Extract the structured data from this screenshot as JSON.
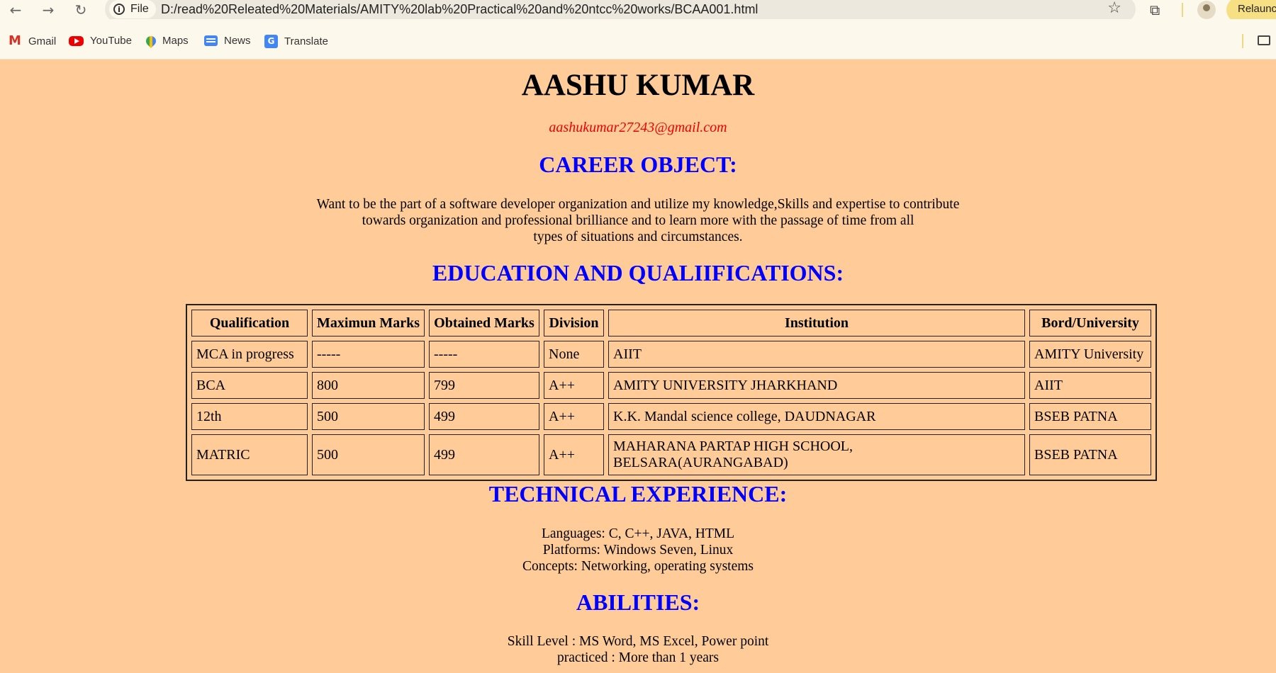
{
  "browser": {
    "chip_label": "File",
    "url": "D:/read%20Releated%20Materials/AMITY%20lab%20Practical%20and%20ntcc%20works/BCAA001.html",
    "relaunch_label": "Relaunch",
    "bookmarks": [
      {
        "label": "Gmail",
        "icon": "gmail-icon"
      },
      {
        "label": "YouTube",
        "icon": "youtube-icon"
      },
      {
        "label": "Maps",
        "icon": "maps-icon"
      },
      {
        "label": "News",
        "icon": "news-icon"
      },
      {
        "label": "Translate",
        "icon": "translate-icon"
      }
    ]
  },
  "resume": {
    "name": "AASHU KUMAR",
    "email": "aashukumar27243@gmail.com",
    "career_heading": "CAREER OBJECT:",
    "career_lines": [
      "Want to be the part of a software developer organization and utilize my knowledge,Skills and expertise to contribute",
      "towards organization and professional brilliance and to learn more with the passage of time from all",
      "types of situations and circumstances."
    ],
    "education_heading": "EDUCATION AND QUALIIFICATIONS:",
    "table": {
      "headers": [
        "Qualification",
        "Maximun Marks",
        "Obtained Marks",
        "Division",
        "Institution",
        "Bord/University"
      ],
      "rows": [
        [
          "MCA in progress",
          "-----",
          "-----",
          "None",
          "AIIT",
          "AMITY University"
        ],
        [
          "BCA",
          "800",
          "799",
          "A++",
          "AMITY UNIVERSITY JHARKHAND",
          "AIIT"
        ],
        [
          "12th",
          "500",
          "499",
          "A++",
          "K.K. Mandal science college, DAUDNAGAR",
          "BSEB PATNA"
        ],
        [
          "MATRIC",
          "500",
          "499",
          "A++",
          "MAHARANA PARTAP HIGH SCHOOL, BELSARA(AURANGABAD)",
          "BSEB PATNA"
        ]
      ]
    },
    "technical_heading": "TECHNICAL EXPERIENCE:",
    "technical_lines": [
      "Languages: C, C++, JAVA, HTML",
      "Platforms: Windows Seven, Linux",
      "Concepts: Networking, operating systems"
    ],
    "abilities_heading": "ABILITIES:",
    "abilities_lines": [
      "Skill Level : MS Word, MS Excel, Power point",
      "practiced : More than 1 years"
    ]
  },
  "colors": {
    "page_bg": "#ffcc99",
    "heading": "#0000ff",
    "email": "#ee0000"
  }
}
